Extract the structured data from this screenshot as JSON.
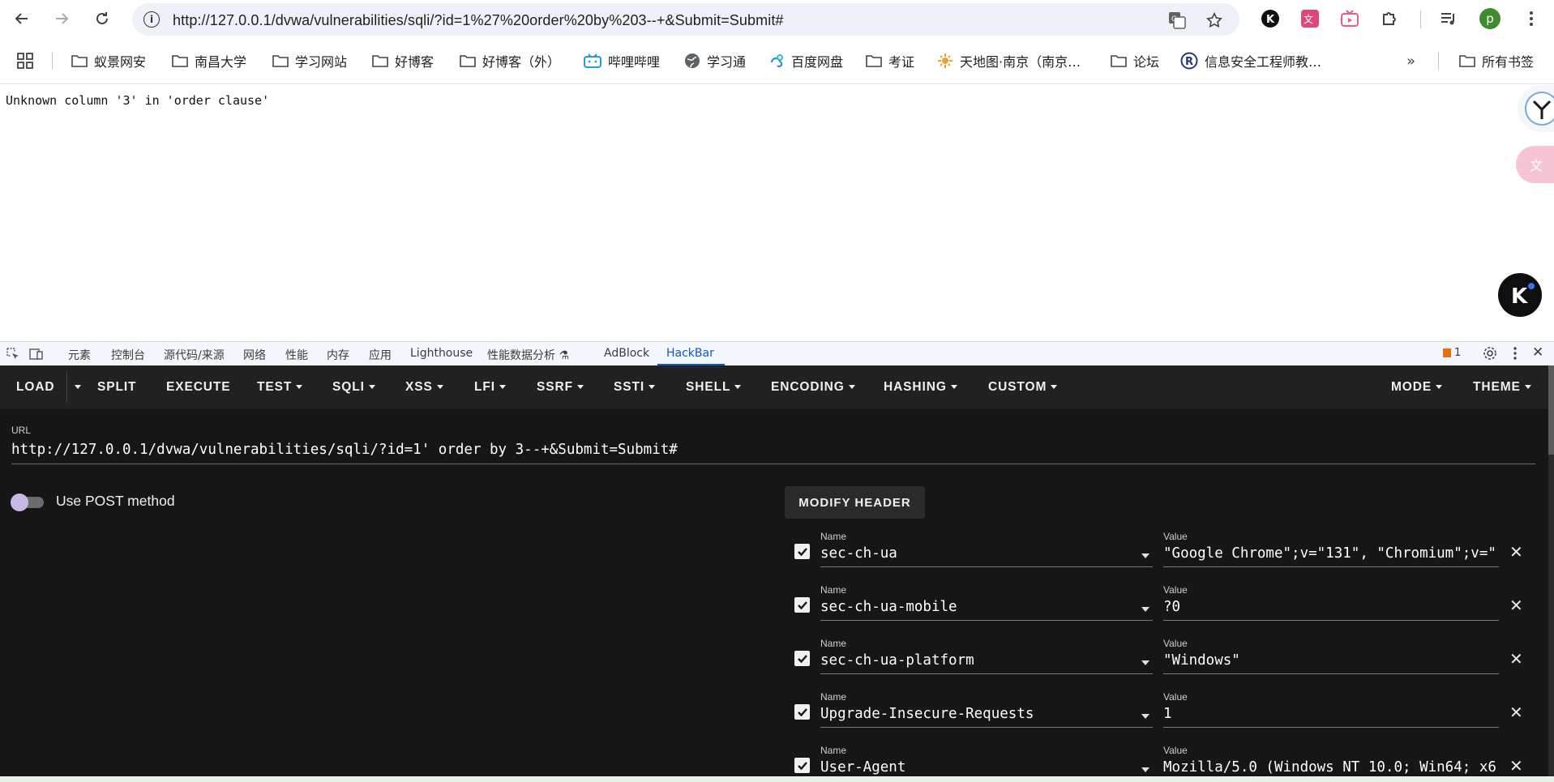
{
  "browser": {
    "url": "http://127.0.0.1/dvwa/vulnerabilities/sqli/?id=1%27%20order%20by%203--+&Submit=Submit#",
    "profile_initial": "p"
  },
  "bookmarks": [
    {
      "label": "蚁景网安",
      "icon": "folder-icon"
    },
    {
      "label": "南昌大学",
      "icon": "folder-icon"
    },
    {
      "label": "学习网站",
      "icon": "folder-icon"
    },
    {
      "label": "好博客",
      "icon": "folder-icon"
    },
    {
      "label": "好博客（外）",
      "icon": "folder-icon"
    },
    {
      "label": "哔哩哔哩",
      "icon": "bilibili-icon"
    },
    {
      "label": "学习通",
      "icon": "globe-icon"
    },
    {
      "label": "百度网盘",
      "icon": "baidu-pan-icon"
    },
    {
      "label": "考证",
      "icon": "folder-icon"
    },
    {
      "label": "天地图·南京（南京…",
      "icon": "tianditu-icon"
    },
    {
      "label": "论坛",
      "icon": "folder-icon"
    },
    {
      "label": "信息安全工程师教…",
      "icon": "r-icon"
    }
  ],
  "all_bookmarks_label": "所有书签",
  "page": {
    "error_text": "Unknown column '3' in 'order clause'"
  },
  "devtools": {
    "tabs": [
      "元素",
      "控制台",
      "源代码/来源",
      "网络",
      "性能",
      "内存",
      "应用",
      "Lighthouse",
      "性能数据分析",
      "AdBlock",
      "HackBar"
    ],
    "active_tab": "HackBar",
    "issues_count": "1"
  },
  "hackbar": {
    "menu": {
      "load": "LOAD",
      "split": "SPLIT",
      "execute": "EXECUTE",
      "test": "TEST",
      "sqli": "SQLI",
      "xss": "XSS",
      "lfi": "LFI",
      "ssrf": "SSRF",
      "ssti": "SSTI",
      "shell": "SHELL",
      "encoding": "ENCODING",
      "hashing": "HASHING",
      "custom": "CUSTOM",
      "mode": "MODE",
      "theme": "THEME"
    },
    "url_label": "URL",
    "url_value": "http://127.0.0.1/dvwa/vulnerabilities/sqli/?id=1' order by 3--+&Submit=Submit#",
    "post_label": "Use POST method",
    "post_enabled": false,
    "modify_header_label": "MODIFY HEADER",
    "name_label": "Name",
    "value_label": "Value",
    "headers": [
      {
        "name": "sec-ch-ua",
        "value": "\"Google Chrome\";v=\"131\", \"Chromium\";v=\"",
        "checked": true
      },
      {
        "name": "sec-ch-ua-mobile",
        "value": "?0",
        "checked": true
      },
      {
        "name": "sec-ch-ua-platform",
        "value": "\"Windows\"",
        "checked": true
      },
      {
        "name": "Upgrade-Insecure-Requests",
        "value": "1",
        "checked": true
      },
      {
        "name": "User-Agent",
        "value": "Mozilla/5.0 (Windows NT 10.0; Win64; x6",
        "checked": true
      }
    ]
  }
}
